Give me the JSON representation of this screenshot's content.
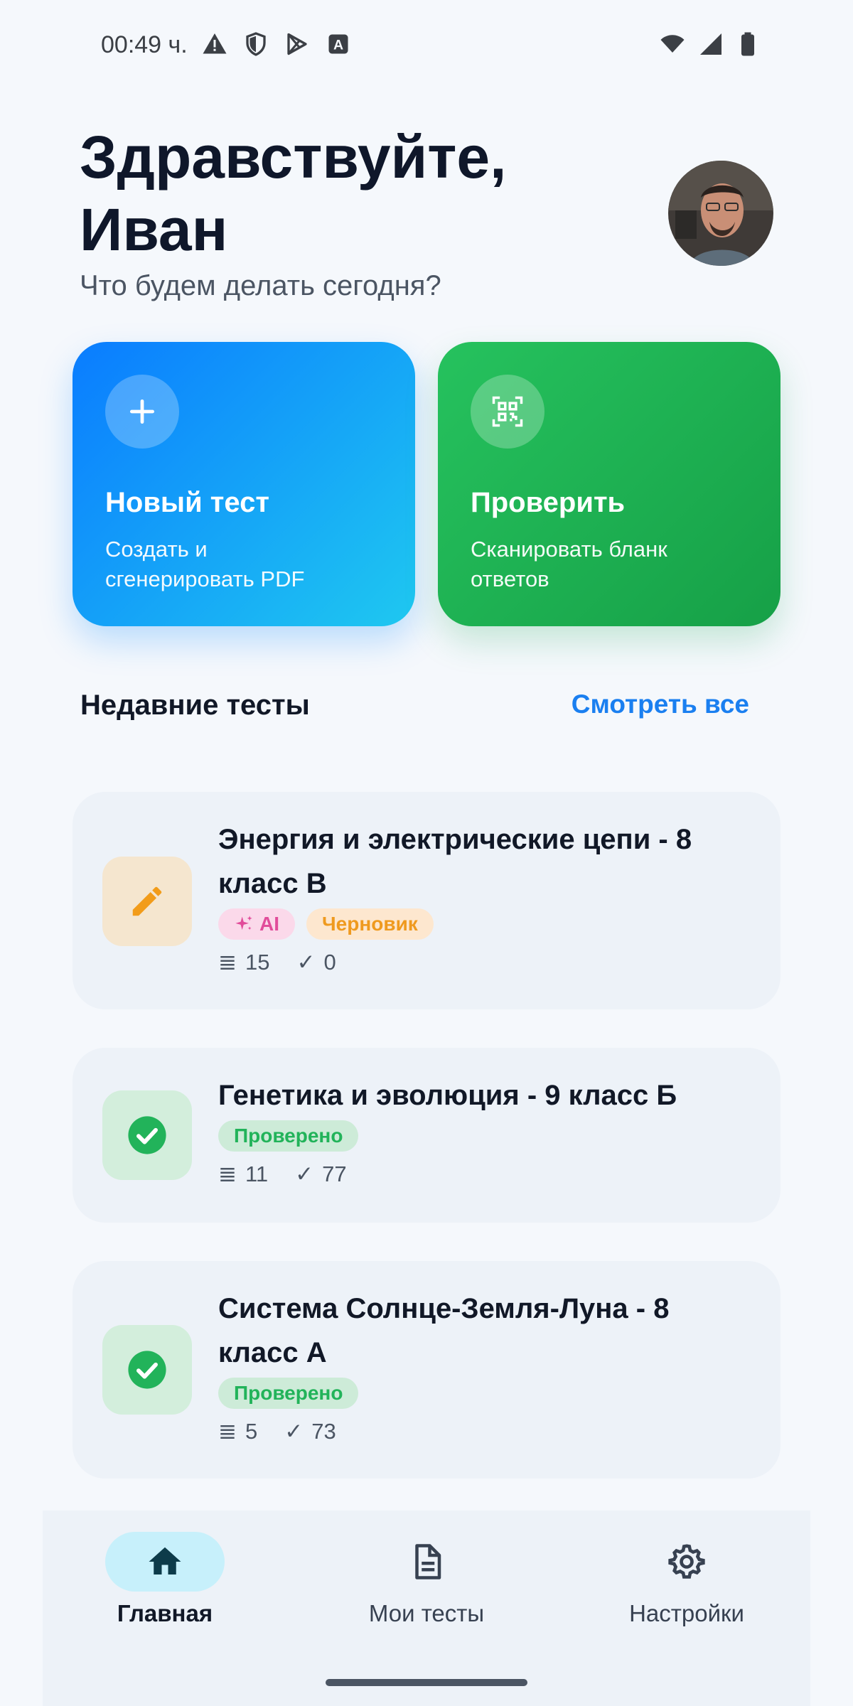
{
  "status_bar": {
    "time": "00:49 ч.",
    "icons_left": [
      "warning-icon",
      "shield-icon",
      "play-store-icon",
      "font-a-icon"
    ],
    "icons_right": [
      "wifi-icon",
      "signal-icon",
      "battery-icon"
    ]
  },
  "header": {
    "greeting": "Здравствуйте,\nИван",
    "subtitle": "Что будем делать сегодня?",
    "avatar_icon": "user-avatar"
  },
  "actions": [
    {
      "title": "Новый тест",
      "description": "Создать и сгенерировать PDF",
      "icon": "plus-icon",
      "color_from": "#0a7cff",
      "color_to": "#1fc8f0"
    },
    {
      "title": "Проверить",
      "description": "Сканировать бланк ответов",
      "icon": "qr-scan-icon",
      "color_from": "#26c25e",
      "color_to": "#16a047"
    }
  ],
  "recent": {
    "title": "Недавние тесты",
    "see_all": "Смотреть все",
    "tests": [
      {
        "title": "Энергия и электрические цепи - 8 класс В",
        "badge_ai": "AI",
        "badge_status": "Черновик",
        "questions": "15",
        "checked": "0",
        "icon": "pencil-icon"
      },
      {
        "title": "Генетика и эволюция - 9 класс Б",
        "badge_status": "Проверено",
        "questions": "11",
        "checked": "77",
        "icon": "check-circle-icon"
      },
      {
        "title": "Система Солнце-Земля-Луна - 8 класс А",
        "badge_status": "Проверено",
        "questions": "5",
        "checked": "73",
        "icon": "check-circle-icon"
      }
    ]
  },
  "nav": {
    "items": [
      {
        "label": "Главная",
        "icon": "home-icon",
        "active": true
      },
      {
        "label": "Мои тесты",
        "icon": "document-icon",
        "active": false
      },
      {
        "label": "Настройки",
        "icon": "gear-icon",
        "active": false
      }
    ]
  },
  "glyphs": {
    "list": "≣",
    "check": "✓"
  },
  "colors": {
    "accent": "#1a7ff0",
    "success": "#22b35a",
    "draft": "#ef9a1f",
    "ai": "#e14c9a"
  }
}
